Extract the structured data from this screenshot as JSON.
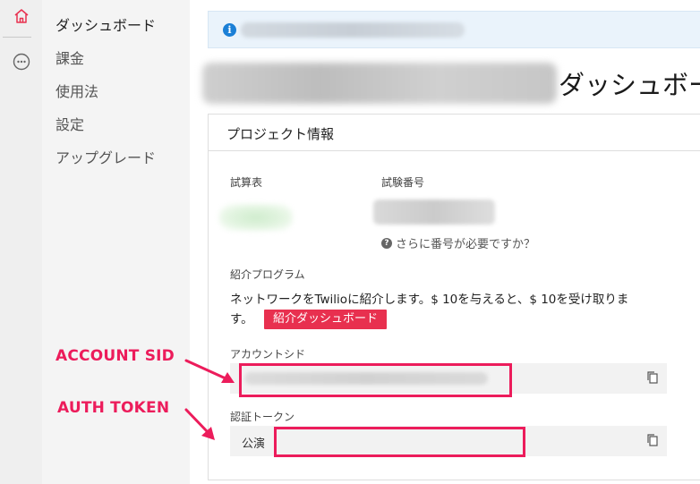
{
  "rail": {
    "home_icon": "home-icon",
    "more_icon": "more-horizontal-icon",
    "accent_color": "#e8304f"
  },
  "sidebar": {
    "items": [
      {
        "label": "ダッシュボード",
        "active": true
      },
      {
        "label": "課金"
      },
      {
        "label": "使用法"
      },
      {
        "label": "設定"
      },
      {
        "label": "アップグレード"
      }
    ]
  },
  "banner": {
    "icon": "info-icon",
    "icon_glyph": "i"
  },
  "page": {
    "title": "ダッシュボー"
  },
  "project_info": {
    "title": "プロジェクト情報",
    "trial_label": "試算表",
    "trial_number_label": "試験番号",
    "need_more_numbers": "さらに番号が必要ですか？",
    "help_glyph": "?",
    "referral": {
      "label": "紹介プログラム",
      "text": "ネットワークをTwilioに紹介します。$ 10を与えると、$ 10を受け取ります。",
      "button_label": "紹介ダッシュボード",
      "button_color": "#e8304f"
    },
    "account_sid": {
      "label": "アカウントシド",
      "copy_icon": "copy-icon"
    },
    "auth_token": {
      "label": "認証トークン",
      "value": "公演",
      "copy_icon": "copy-icon"
    }
  },
  "annotations": {
    "account_sid_label": "ACCOUNT SID",
    "auth_token_label": "AUTH TOKEN",
    "color": "#ec1c5b"
  }
}
